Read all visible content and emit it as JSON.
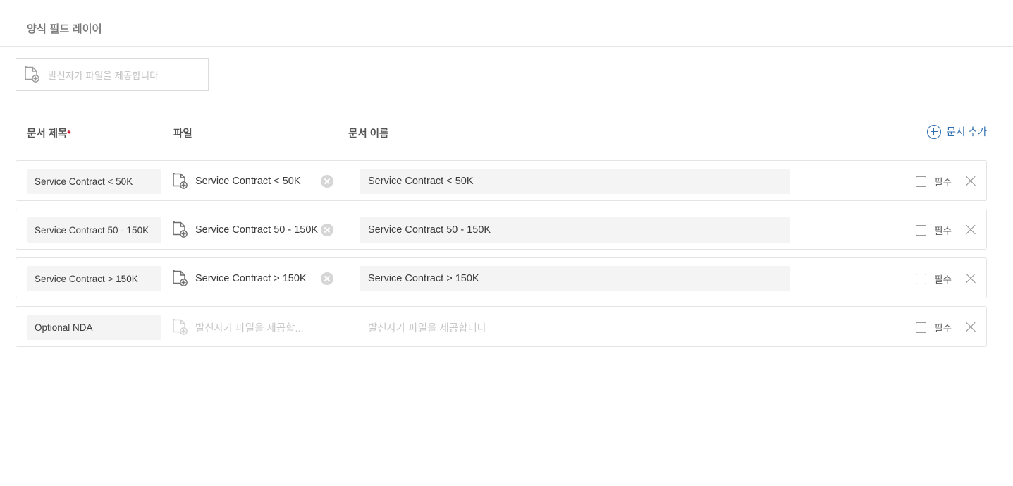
{
  "section": {
    "title": "양식 필드 레이어"
  },
  "top_file_field": {
    "icon": "file-add-icon",
    "placeholder": "발신자가 파일을 제공합니다"
  },
  "table": {
    "columns": {
      "title": "문서 제목",
      "title_required_mark": "*",
      "file": "파일",
      "name": "문서 이름"
    },
    "add_button": {
      "label": "문서 추가",
      "icon": "plus-circle-icon",
      "color": "#2f6fb0"
    },
    "required_label": "필수",
    "file_placeholder_truncated": "발신자가 파일을 제공합...",
    "name_placeholder": "발신자가 파일을 제공합니다",
    "rows": [
      {
        "title": "Service Contract <  50K",
        "file_name": "Service Contract < 50K",
        "has_file": true,
        "doc_name": "Service Contract  <  50K",
        "doc_name_is_placeholder": false,
        "required_checked": false
      },
      {
        "title": "Service Contract 50 - 150K",
        "file_name": "Service Contract 50 - 150K",
        "has_file": true,
        "doc_name": "Service Contract 50 - 150K",
        "doc_name_is_placeholder": false,
        "required_checked": false
      },
      {
        "title": "Service Contract  >  150K",
        "file_name": "Service Contract > 150K",
        "has_file": true,
        "doc_name": "Service Contract  >  150K",
        "doc_name_is_placeholder": false,
        "required_checked": false
      },
      {
        "title": "Optional NDA",
        "file_name": "발신자가 파일을 제공합...",
        "has_file": false,
        "doc_name": "발신자가 파일을 제공합니다",
        "doc_name_is_placeholder": true,
        "required_checked": false
      }
    ]
  },
  "colors": {
    "accent": "#2f6fb0",
    "required_star": "#d0021b",
    "input_bg": "#f4f4f4",
    "border": "#e4e4e4",
    "placeholder": "#c8c8c8"
  }
}
